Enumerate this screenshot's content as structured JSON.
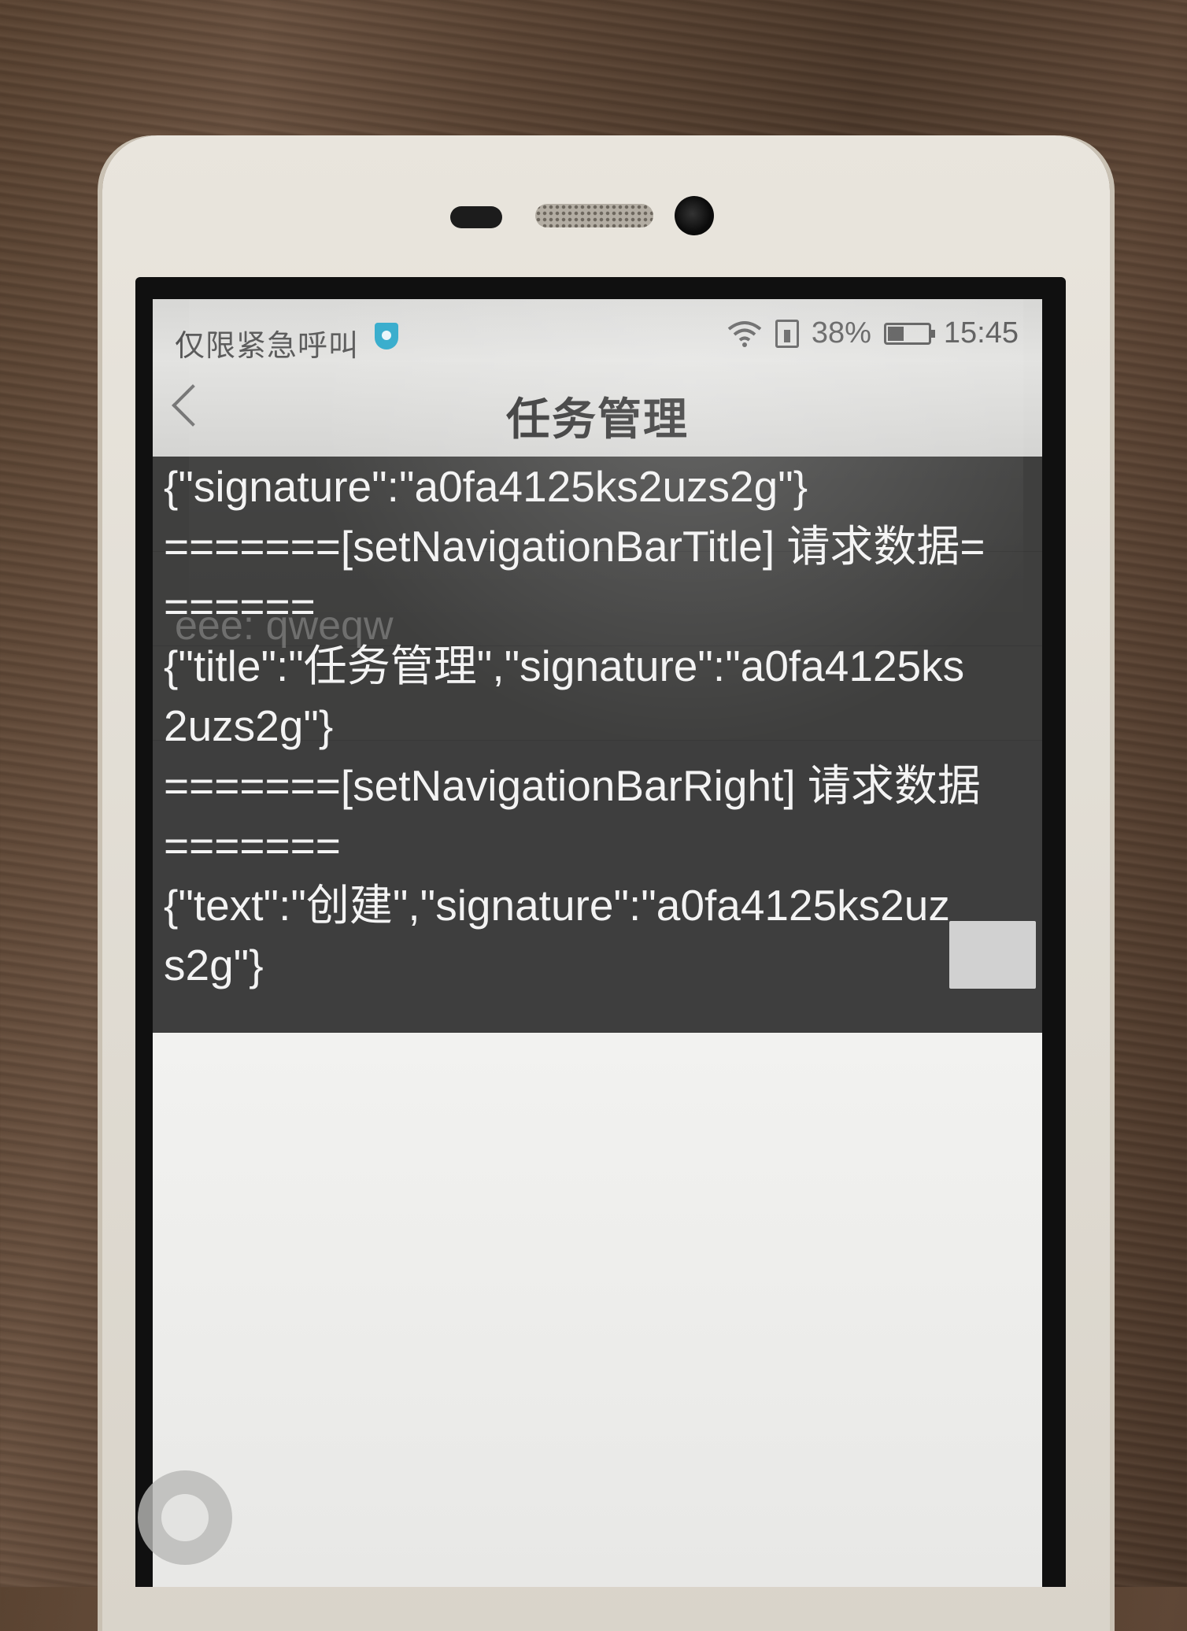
{
  "status_bar": {
    "carrier": "仅限紧急呼叫",
    "battery_percent": "38%",
    "battery_level": 0.38,
    "time": "15:45"
  },
  "nav": {
    "title": "任务管理"
  },
  "background": {
    "ghost_text": "eee: qweqw"
  },
  "debug_log": {
    "lines": [
      "{\"signature\":\"a0fa4125ks2uzs2g\"}",
      "=======[setNavigationBarTitle] 请求数据=",
      "======",
      "{\"title\":\"任务管理\",\"signature\":\"a0fa4125ks",
      "2uzs2g\"}",
      "=======[setNavigationBarRight] 请求数据",
      "=======",
      "{\"text\":\"创建\",\"signature\":\"a0fa4125ks2uz",
      "s2g\"}"
    ]
  }
}
